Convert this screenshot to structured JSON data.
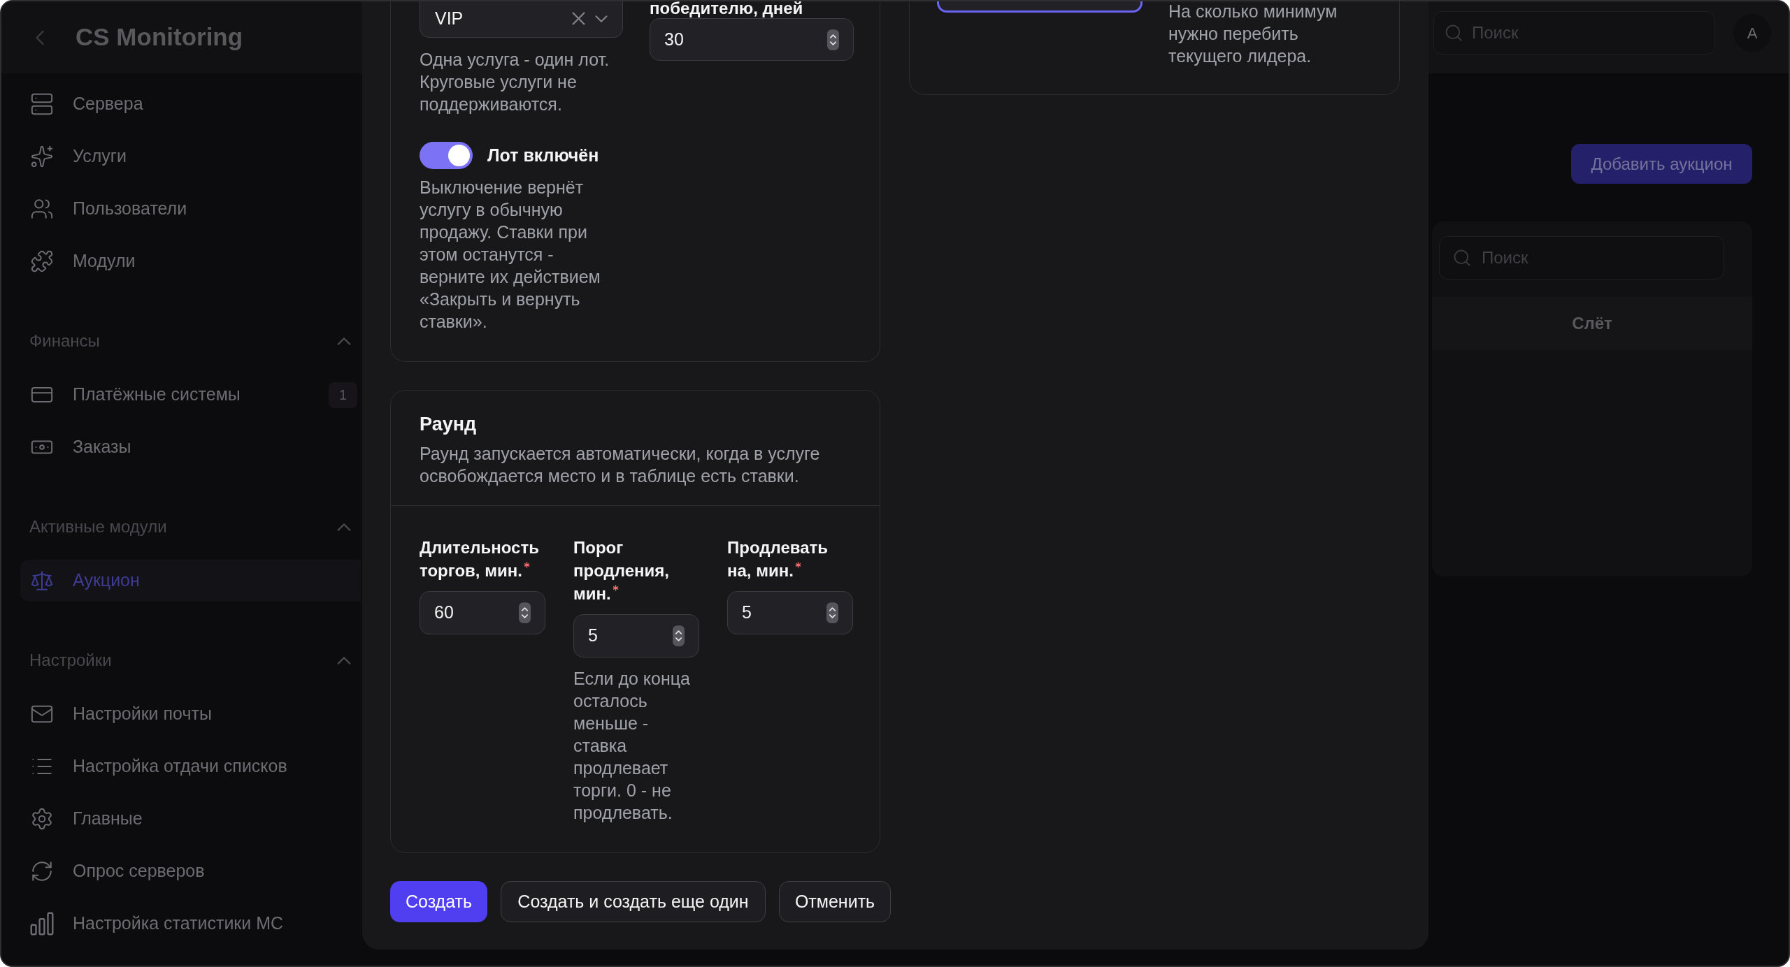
{
  "sidebar": {
    "title": "CS Monitoring",
    "groups": [
      {
        "items": [
          {
            "label": "Сервера",
            "selected": false
          },
          {
            "label": "Услуги",
            "selected": false
          },
          {
            "label": "Пользователи",
            "selected": false
          },
          {
            "label": "Модули",
            "selected": false
          }
        ]
      },
      {
        "title": "Финансы",
        "expanded": true,
        "items": [
          {
            "label": "Платёжные системы",
            "selected": false,
            "badge": "1"
          },
          {
            "label": "Заказы",
            "selected": false
          }
        ]
      },
      {
        "title": "Активные модули",
        "expanded": true,
        "items": [
          {
            "label": "Аукцион",
            "selected": true
          }
        ]
      },
      {
        "title": "Настройки",
        "expanded": true,
        "items": [
          {
            "label": "Настройки почты",
            "selected": false
          },
          {
            "label": "Настройка отдачи списков",
            "selected": false
          },
          {
            "label": "Главные",
            "selected": false
          },
          {
            "label": "Опрос серверов",
            "selected": false
          },
          {
            "label": "Настройка статистики МС",
            "selected": false
          }
        ]
      }
    ]
  },
  "topbar": {
    "search": {
      "placeholder": "Поиск"
    },
    "avatar": "A"
  },
  "page": {
    "add_button": "Добавить аукцион",
    "table": {
      "search": {
        "placeholder": "Поиск"
      },
      "columns": [
        "Слёт"
      ]
    }
  },
  "modal": {
    "lot_card": {
      "service_select": {
        "value": "VIP",
        "clearable": true
      },
      "service_hint": "Одна услуга - один лот. Круговые услуги не поддерживаются.",
      "enabled_toggle": {
        "label": "Лот включён",
        "on": true
      },
      "toggle_hint": "Выключение вернёт услугу в обычную продажу. Ставки при этом останутся - верните их действием «Закрыть и вернуть ставки».",
      "days_field": {
        "label": "победителю, дней",
        "value": "30"
      }
    },
    "bid_step_card": {
      "field": {
        "focused": true
      },
      "hint": "На сколько минимум нужно перебить текущего лидера."
    },
    "round_card": {
      "title": "Раунд",
      "description": "Раунд запускается автоматически, когда в услуге освобождается место и в таблице есть ставки.",
      "fields": [
        {
          "label": "Длительность торгов, мин.",
          "required": true,
          "value": "60"
        },
        {
          "label": "Порог продления, мин.",
          "required": true,
          "value": "5",
          "hint": "Если до конца осталось меньше - ставка продлевает торги. 0 - не продлевать."
        },
        {
          "label": "Продлевать на, мин.",
          "required": true,
          "value": "5"
        }
      ]
    },
    "buttons": [
      {
        "label": "Создать",
        "kind": "primary"
      },
      {
        "label": "Создать и создать еще один",
        "kind": "secondary"
      },
      {
        "label": "Отменить",
        "kind": "secondary"
      }
    ]
  }
}
